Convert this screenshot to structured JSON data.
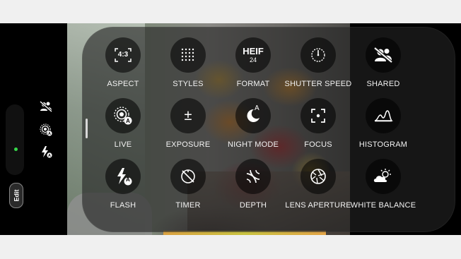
{
  "left_bar": {
    "indicators": [
      {
        "icon": "shared-off-icon"
      },
      {
        "icon": "live-photo-icon"
      },
      {
        "icon": "flash-auto-icon"
      }
    ],
    "edit_label": "Edit",
    "status_dot_color": "#36d84a"
  },
  "controls": [
    {
      "label": "ASPECT",
      "icon": "aspect-ratio-icon",
      "icon_text": "4:3"
    },
    {
      "label": "STYLES",
      "icon": "styles-grid-icon"
    },
    {
      "label": "FORMAT",
      "icon": "format-icon",
      "icon_text": "HEIF",
      "icon_subtext": "24"
    },
    {
      "label": "SHUTTER SPEED",
      "icon": "shutter-speed-icon"
    },
    {
      "label": "SHARED",
      "icon": "shared-off-icon"
    },
    {
      "label": "LIVE",
      "icon": "live-photo-icon"
    },
    {
      "label": "EXPOSURE",
      "icon": "exposure-icon",
      "icon_text": "±"
    },
    {
      "label": "NIGHT MODE",
      "icon": "night-mode-icon",
      "icon_text": "A"
    },
    {
      "label": "FOCUS",
      "icon": "focus-icon"
    },
    {
      "label": "HISTOGRAM",
      "icon": "histogram-icon"
    },
    {
      "label": "FLASH",
      "icon": "flash-auto-icon",
      "icon_text": "A"
    },
    {
      "label": "TIMER",
      "icon": "timer-off-icon"
    },
    {
      "label": "DEPTH",
      "icon": "depth-icon"
    },
    {
      "label": "LENS APERTURE",
      "icon": "lens-aperture-icon"
    },
    {
      "label": "WHITE BALANCE",
      "icon": "white-balance-icon"
    }
  ]
}
